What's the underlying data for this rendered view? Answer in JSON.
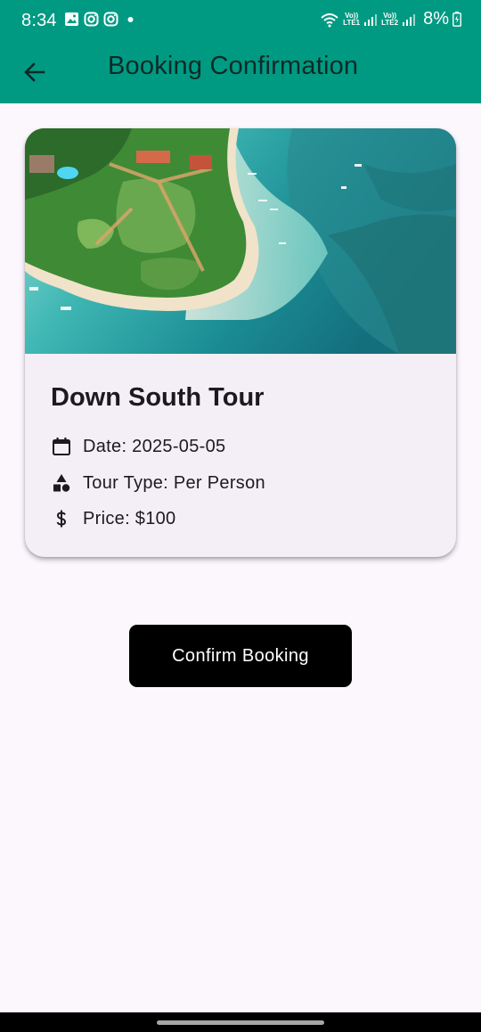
{
  "status_bar": {
    "time": "8:34",
    "left_icons": [
      "gallery-icon",
      "instagram-icon",
      "instagram-icon",
      "notification-dot-icon"
    ],
    "network_1": "LTE1",
    "network_2": "LTE2",
    "volte_1": "Vo))",
    "volte_2": "Vo))",
    "battery": "8%"
  },
  "app_bar": {
    "title": "Booking Confirmation",
    "back_icon": "arrow-left-icon",
    "color": "#009a83"
  },
  "tour": {
    "name": "Down South Tour",
    "image_alt": "aerial beach",
    "date_text": "Date: 2025-05-05",
    "type_text": "Tour Type: Per Person",
    "price_text": "Price: $100",
    "date_icon": "calendar-icon",
    "type_icon": "category-icon",
    "price_icon": "dollar-icon"
  },
  "actions": {
    "confirm_label": "Confirm Booking"
  },
  "colors": {
    "accent": "#009a83",
    "background": "#fcf6fd",
    "card": "#f4eff6",
    "button": "#000000"
  }
}
